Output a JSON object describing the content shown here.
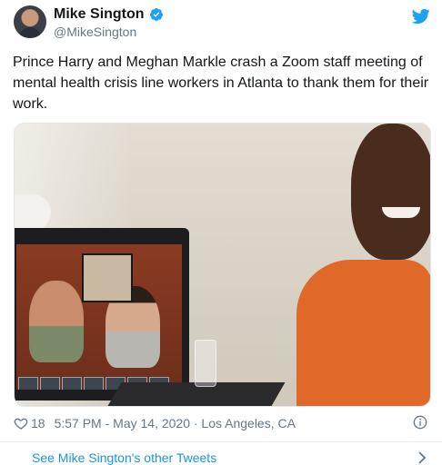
{
  "author": {
    "display_name": "Mike Sington",
    "handle": "@MikeSington",
    "verified": true,
    "avatar_icon": "avatar"
  },
  "brand": {
    "icon": "twitter-bird-icon",
    "color": "#1da1f2"
  },
  "tweet": {
    "text": "Prince Harry and Meghan Markle crash a Zoom staff meeting of mental health crisis line workers in Atlanta to thank them for their work."
  },
  "meta": {
    "likes": "18",
    "time": "5:57 PM - May 14, 2020 · Los Angeles, CA"
  },
  "footer": {
    "see_more": "See Mike Sington's other Tweets"
  },
  "colors": {
    "text": "#14171a",
    "muted": "#657786",
    "link": "#1b95e0",
    "verified": "#1da1f2"
  }
}
